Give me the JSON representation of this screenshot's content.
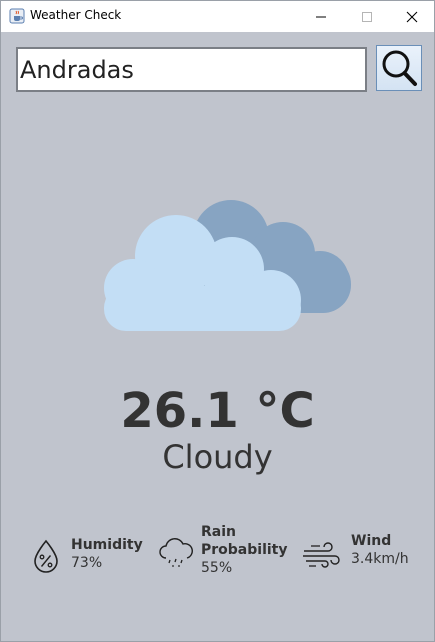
{
  "window": {
    "title": "Weather Check",
    "icon": "java-cup-icon"
  },
  "search": {
    "value": "Andradas",
    "button_icon": "search-icon"
  },
  "weather": {
    "icon": "cloudy-icon",
    "temperature": "26.1 °C",
    "condition": "Cloudy"
  },
  "stats": {
    "humidity": {
      "label": "Humidity",
      "value": "73%",
      "icon": "humidity-icon"
    },
    "rain": {
      "label_line1": "Rain",
      "label_line2": "Probability",
      "value": "55%",
      "icon": "rain-cloud-icon"
    },
    "wind": {
      "label": "Wind",
      "value": "3.4km/h",
      "icon": "wind-icon"
    }
  },
  "colors": {
    "background": "#c0c4cd",
    "cloud_front": "#c3def5",
    "cloud_back": "#87a4c2",
    "text": "#333333"
  }
}
